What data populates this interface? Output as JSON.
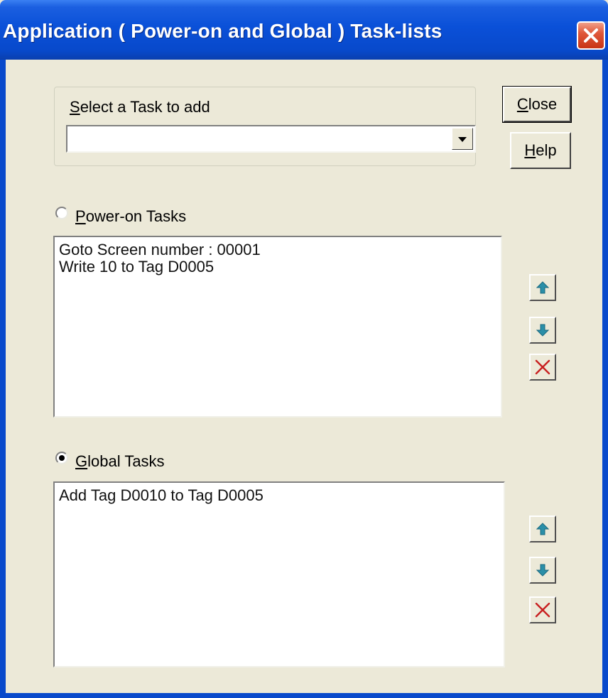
{
  "window": {
    "title": "Application ( Power-on and Global ) Task-lists"
  },
  "task_select": {
    "label_prefix": "",
    "label_accel": "S",
    "label_rest": "elect a Task to add",
    "value": ""
  },
  "buttons": {
    "close_accel": "C",
    "close_rest": "lose",
    "help_accel": "H",
    "help_rest": "elp"
  },
  "power_on": {
    "accel": "P",
    "label_rest": "ower-on Tasks",
    "selected": false,
    "items": [
      "Goto Screen number : 00001",
      "Write 10 to Tag D0005"
    ]
  },
  "global": {
    "accel": "G",
    "label_rest": "lobal Tasks",
    "selected": true,
    "items": [
      "Add Tag D0010 to Tag D0005"
    ]
  },
  "icons": {
    "move_up": "arrow-up-icon",
    "move_down": "arrow-down-icon",
    "delete": "delete-x-icon"
  },
  "colors": {
    "titlebar": "#0a50d8",
    "face": "#ece9d8",
    "arrow": "#2a8fa8",
    "delete": "#c82020"
  }
}
